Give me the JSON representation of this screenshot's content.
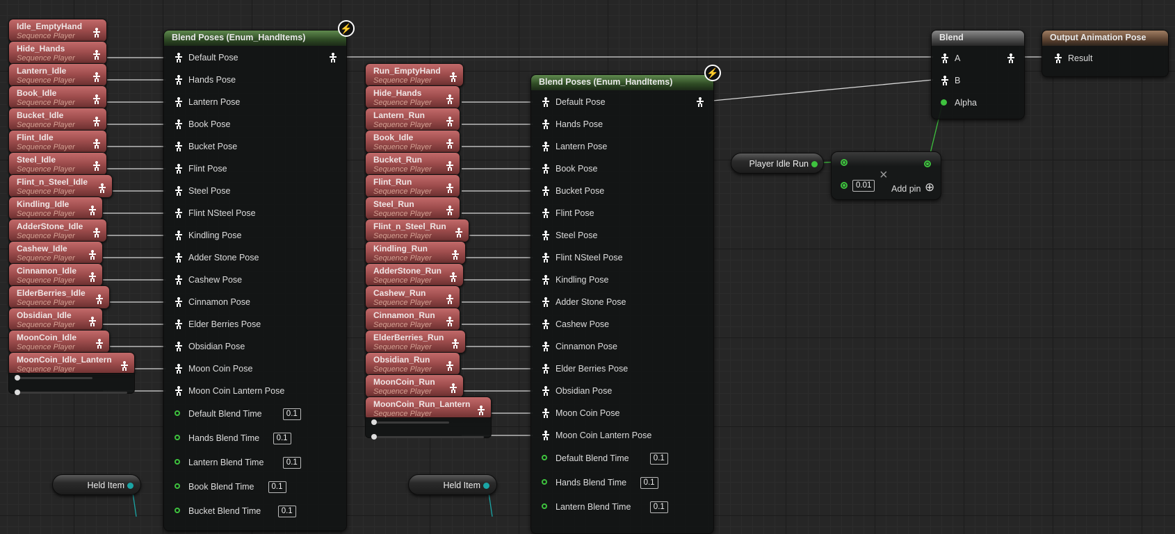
{
  "colors": {
    "pose_wire": "#d9d9d9",
    "float_wire": "#3ec23e",
    "enum_wire": "#1aa5a5"
  },
  "idle_sequences": [
    {
      "name": "Idle_EmptyHand",
      "sub": "Sequence Player"
    },
    {
      "name": "Hide_Hands",
      "sub": "Sequence Player"
    },
    {
      "name": "Lantern_Idle",
      "sub": "Sequence Player"
    },
    {
      "name": "Book_Idle",
      "sub": "Sequence Player"
    },
    {
      "name": "Bucket_Idle",
      "sub": "Sequence Player"
    },
    {
      "name": "Flint_Idle",
      "sub": "Sequence Player"
    },
    {
      "name": "Steel_Idle",
      "sub": "Sequence Player"
    },
    {
      "name": "Flint_n_Steel_Idle",
      "sub": "Sequence Player"
    },
    {
      "name": "Kindling_Idle",
      "sub": "Sequence Player"
    },
    {
      "name": "AdderStone_Idle",
      "sub": "Sequence Player"
    },
    {
      "name": "Cashew_Idle",
      "sub": "Sequence Player"
    },
    {
      "name": "Cinnamon_Idle",
      "sub": "Sequence Player"
    },
    {
      "name": "ElderBerries_Idle",
      "sub": "Sequence Player"
    },
    {
      "name": "Obsidian_Idle",
      "sub": "Sequence Player"
    },
    {
      "name": "MoonCoin_Idle",
      "sub": "Sequence Player"
    },
    {
      "name": "MoonCoin_Idle_Lantern",
      "sub": "Sequence Player"
    }
  ],
  "run_sequences": [
    {
      "name": "Run_EmptyHand",
      "sub": "Sequence Player"
    },
    {
      "name": "Hide_Hands",
      "sub": "Sequence Player"
    },
    {
      "name": "Lantern_Run",
      "sub": "Sequence Player"
    },
    {
      "name": "Book_Idle",
      "sub": "Sequence Player"
    },
    {
      "name": "Bucket_Run",
      "sub": "Sequence Player"
    },
    {
      "name": "Flint_Run",
      "sub": "Sequence Player"
    },
    {
      "name": "Steel_Run",
      "sub": "Sequence Player"
    },
    {
      "name": "Flint_n_Steel_Run",
      "sub": "Sequence Player"
    },
    {
      "name": "Kindling_Run",
      "sub": "Sequence Player"
    },
    {
      "name": "AdderStone_Run",
      "sub": "Sequence Player"
    },
    {
      "name": "Cashew_Run",
      "sub": "Sequence Player"
    },
    {
      "name": "Cinnamon_Run",
      "sub": "Sequence Player"
    },
    {
      "name": "ElderBerries_Run",
      "sub": "Sequence Player"
    },
    {
      "name": "Obsidian_Run",
      "sub": "Sequence Player"
    },
    {
      "name": "MoonCoin_Run",
      "sub": "Sequence Player"
    },
    {
      "name": "MoonCoin_Run_Lantern",
      "sub": "Sequence Player"
    }
  ],
  "blend1": {
    "title": "Blend Poses (Enum_HandItems)",
    "poses": [
      "Default Pose",
      "Hands Pose",
      "Lantern Pose",
      "Book Pose",
      "Bucket Pose",
      "Flint Pose",
      "Steel Pose",
      "Flint NSteel Pose",
      "Kindling Pose",
      "Adder Stone Pose",
      "Cashew Pose",
      "Cinnamon Pose",
      "Elder Berries Pose",
      "Obsidian Pose",
      "Moon Coin Pose",
      "Moon Coin Lantern Pose"
    ],
    "blend_times": [
      {
        "label": "Default Blend Time",
        "value": "0.1"
      },
      {
        "label": "Hands Blend Time",
        "value": "0.1"
      },
      {
        "label": "Lantern Blend Time",
        "value": "0.1"
      },
      {
        "label": "Book Blend Time",
        "value": "0.1"
      },
      {
        "label": "Bucket Blend Time",
        "value": "0.1"
      }
    ]
  },
  "blend2": {
    "title": "Blend Poses (Enum_HandItems)",
    "poses": [
      "Default Pose",
      "Hands Pose",
      "Lantern Pose",
      "Book Pose",
      "Bucket Pose",
      "Flint Pose",
      "Steel Pose",
      "Flint NSteel Pose",
      "Kindling Pose",
      "Adder Stone Pose",
      "Cashew Pose",
      "Cinnamon Pose",
      "Elder Berries Pose",
      "Obsidian Pose",
      "Moon Coin Pose",
      "Moon Coin Lantern Pose"
    ],
    "blend_times": [
      {
        "label": "Default Blend Time",
        "value": "0.1"
      },
      {
        "label": "Hands Blend Time",
        "value": "0.1"
      },
      {
        "label": "Lantern Blend Time",
        "value": "0.1"
      }
    ]
  },
  "held_item": {
    "label": "Held Item"
  },
  "blend": {
    "title": "Blend",
    "a": "A",
    "b": "B",
    "alpha": "Alpha"
  },
  "output": {
    "title": "Output Animation Pose",
    "result": "Result"
  },
  "player_idle_run": {
    "label": "Player Idle Run"
  },
  "multiply": {
    "symbol": "×",
    "value": "0.01",
    "add_pin": "Add pin",
    "add_pin_icon": "⊕"
  },
  "badge_icon": "⚡"
}
